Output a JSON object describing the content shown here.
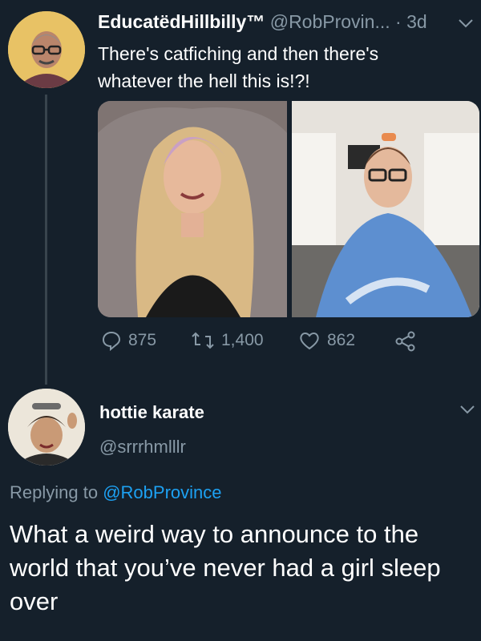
{
  "tweet1": {
    "display_name": "EducatëdHillbilly™",
    "handle": "@RobProvin...",
    "time": "· 3d",
    "text": "There's catfiching and then there's whatever the hell this is!?!",
    "actions": {
      "replies": "875",
      "retweets": "1,400",
      "likes": "862"
    }
  },
  "tweet2": {
    "display_name": "hottie karate",
    "handle": "@srrrhmlllr",
    "replying_prefix": "Replying to",
    "replying_handle": "@RobProvince",
    "text": "What a weird way to announce to the world that you’ve never had a girl sleep over"
  },
  "icons": [
    "chevron-down-icon",
    "reply-icon",
    "retweet-icon",
    "like-icon",
    "share-icon"
  ],
  "colors": {
    "background": "#15202b",
    "muted": "#8899a6",
    "link": "#1da1f2",
    "text": "#ffffff"
  }
}
